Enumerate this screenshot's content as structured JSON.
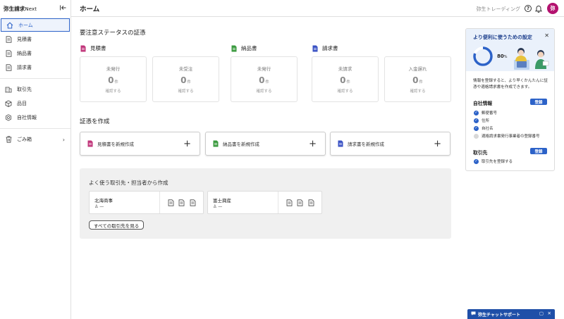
{
  "brand": {
    "name": "弥生請求",
    "suffix": "Next"
  },
  "sidebar": {
    "items": [
      {
        "label": "ホーム",
        "icon": "home-icon"
      },
      {
        "label": "見積書",
        "icon": "document-icon"
      },
      {
        "label": "納品書",
        "icon": "document-icon"
      },
      {
        "label": "請求書",
        "icon": "document-icon"
      },
      {
        "label": "取引先",
        "icon": "building-icon"
      },
      {
        "label": "品目",
        "icon": "box-icon"
      },
      {
        "label": "自社情報",
        "icon": "gear-icon"
      },
      {
        "label": "ごみ箱",
        "icon": "trash-icon"
      }
    ]
  },
  "header": {
    "title": "ホーム",
    "company": "弥生トレーディング",
    "avatar": "弥"
  },
  "status": {
    "title": "要注意ステータスの証憑",
    "groups": [
      {
        "label": "見積書",
        "color": "#c0357a"
      },
      {
        "label": "納品書",
        "color": "#3a9a3e"
      },
      {
        "label": "請求書",
        "color": "#3a52c4"
      }
    ],
    "cards": [
      {
        "label": "未発行",
        "value": "0",
        "unit": "件",
        "action": "確認する"
      },
      {
        "label": "未受注",
        "value": "0",
        "unit": "件",
        "action": "確認する"
      },
      {
        "label": "未発行",
        "value": "0",
        "unit": "件",
        "action": "確認する"
      },
      {
        "label": "未請求",
        "value": "0",
        "unit": "件",
        "action": "確認する"
      },
      {
        "label": "入金遅れ",
        "value": "0",
        "unit": "件",
        "action": "確認する"
      }
    ]
  },
  "create": {
    "title": "証憑を作成",
    "buttons": [
      {
        "label": "見積書を新規作成"
      },
      {
        "label": "納品書を新規作成"
      },
      {
        "label": "請求書を新規作成"
      }
    ]
  },
  "frequent": {
    "title": "よく使う取引先・担当者から作成",
    "customers": [
      {
        "name": "北海商事",
        "person": "—"
      },
      {
        "name": "富士興産",
        "person": "—"
      }
    ],
    "all_button": "すべての取引先を見る"
  },
  "setup": {
    "title": "より便利に使うための設定",
    "progress": 80,
    "pct_unit": "%",
    "desc": "情報を登録すると、より早くかんたんに証憑や適格請求書を作成できます。",
    "company_head": "自社情報",
    "register": "登録",
    "company_items": [
      {
        "label": "郵便番号",
        "done": true
      },
      {
        "label": "住所",
        "done": true
      },
      {
        "label": "自社名",
        "done": true
      },
      {
        "label": "適格請求書発行事業者の登録番号",
        "done": false
      }
    ],
    "customer_head": "取引先",
    "customer_items": [
      {
        "label": "取引先を登録する",
        "done": true
      }
    ]
  },
  "chat": {
    "label": "弥生チャットサポート"
  }
}
